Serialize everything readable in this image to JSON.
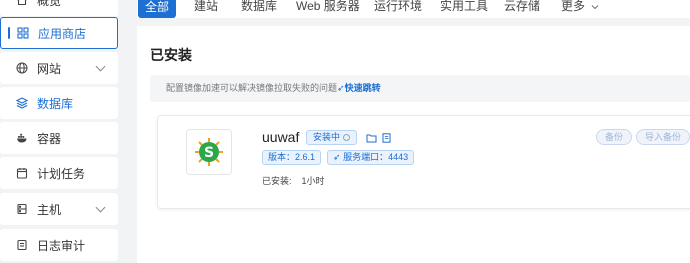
{
  "sidebar": {
    "items": [
      {
        "label": "概览"
      },
      {
        "label": "应用商店"
      },
      {
        "label": "网站"
      },
      {
        "label": "数据库"
      },
      {
        "label": "容器"
      },
      {
        "label": "计划任务"
      },
      {
        "label": "主机"
      },
      {
        "label": "日志审计"
      }
    ]
  },
  "tabs": [
    "全部",
    "建站",
    "数据库",
    "Web 服务器",
    "运行环境",
    "实用工具",
    "云存储",
    "更多"
  ],
  "main": {
    "title": "已安装",
    "notice_text": "配置镜像加速可以解决镜像拉取失败的问题",
    "notice_link": "快速跳转"
  },
  "app": {
    "name": "uuwaf",
    "status": "安装中",
    "version_tag": "版本：2.6.1",
    "port_tag": "服务端口：4443",
    "installed_label": "已安装:",
    "installed_time": "1小时",
    "backup_button": "备份",
    "import_button": "导入备份"
  },
  "colors": {
    "accent": "#1d6fd1",
    "logo_green": "#2aa84a",
    "logo_orange": "#f0a020"
  }
}
